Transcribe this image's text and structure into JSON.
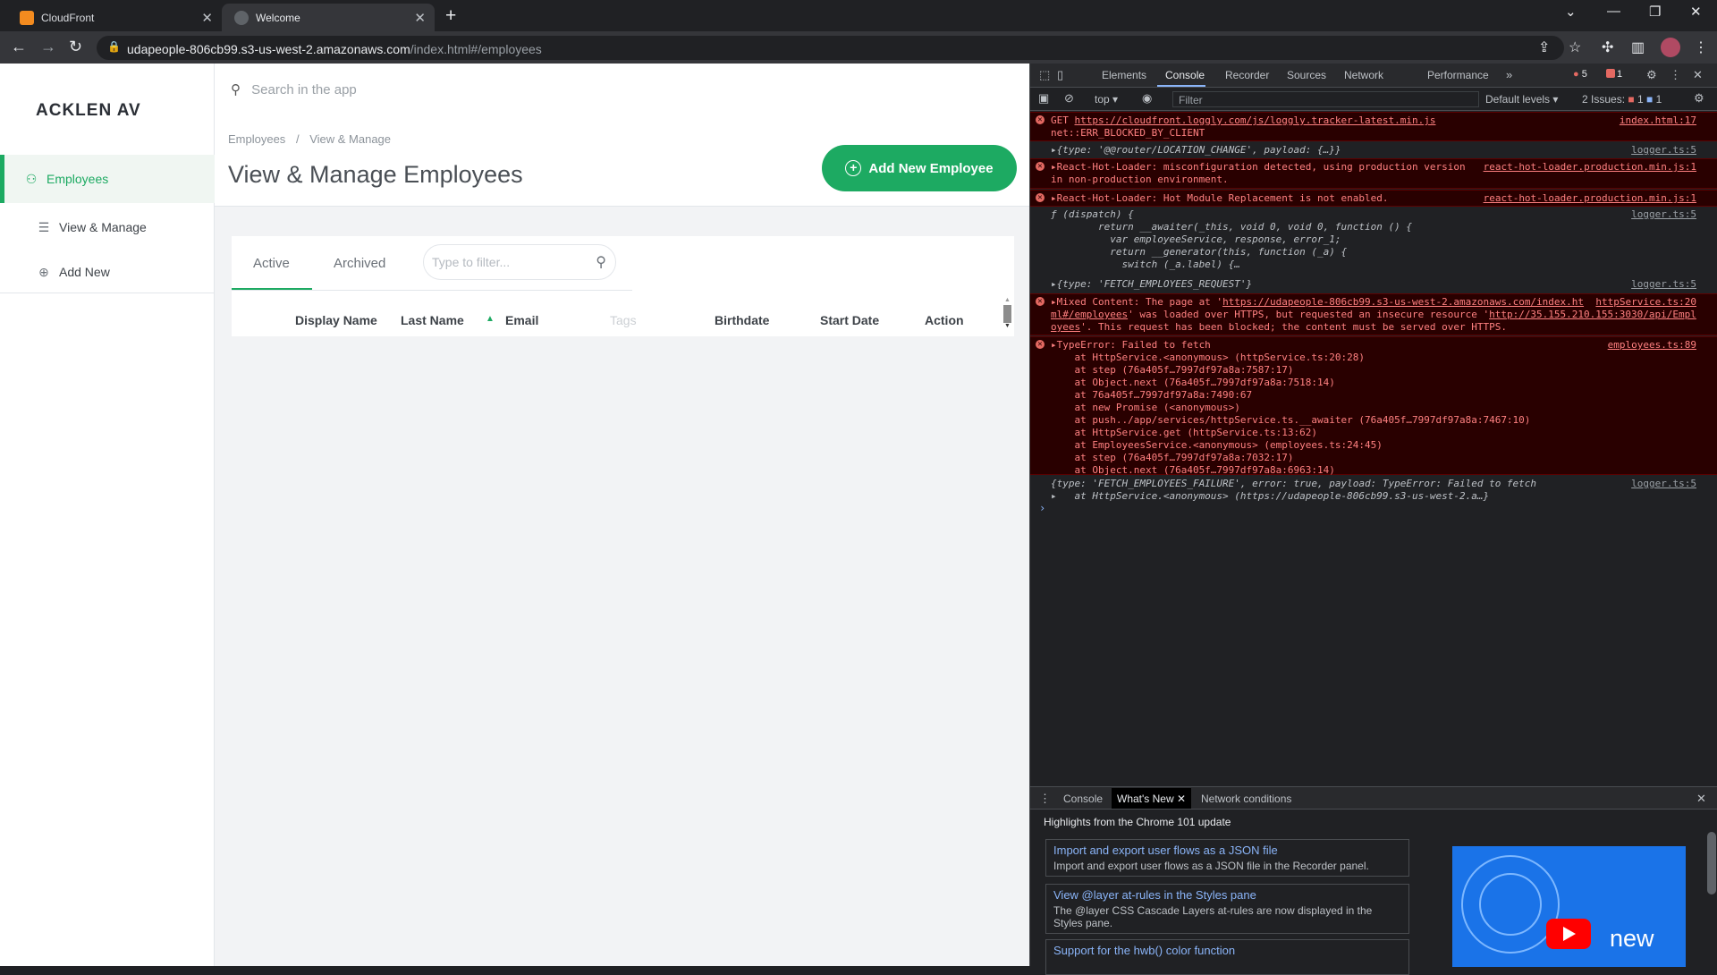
{
  "browser": {
    "tabs": [
      {
        "title": "CloudFront",
        "active": false,
        "favicon_color": "#f38b1f"
      },
      {
        "title": "Welcome",
        "active": true,
        "favicon_color": "#9aa0a6"
      }
    ],
    "url_host": "udapeople-806cb99.s3-us-west-2.amazonaws.com",
    "url_path": "/index.html#/employees"
  },
  "app": {
    "logo": "ACKLEN AV",
    "search_placeholder": "Search in the app",
    "sidebar": [
      {
        "label": "Employees",
        "icon": "user-icon",
        "active": true
      },
      {
        "label": "View & Manage",
        "icon": "list-icon",
        "active": false
      },
      {
        "label": "Add New",
        "icon": "plus-circle-icon",
        "active": false
      }
    ],
    "breadcrumb": {
      "root": "Employees",
      "sep": "/",
      "current": "View & Manage"
    },
    "page_title": "View & Manage Employees",
    "add_button": "Add New Employee",
    "filter_tabs": [
      "Active",
      "Archived"
    ],
    "filter_placeholder": "Type to filter...",
    "columns": [
      "Display Name",
      "Last Name",
      "Email",
      "Tags",
      "Birthdate",
      "Start Date",
      "Action"
    ],
    "accent_color": "#1daa62"
  },
  "devtools": {
    "tabs": [
      "Elements",
      "Console",
      "Recorder",
      "Sources",
      "Network",
      "Performance"
    ],
    "active_tab": "Console",
    "error_count": "5",
    "issue_count": "1",
    "context": "top",
    "filter_placeholder": "Filter",
    "levels": "Default levels",
    "issues_label": "2 Issues:",
    "issues_err": "1",
    "issues_info": "1",
    "messages": {
      "m1a": "GET ",
      "m1url": "https://cloudfront.loggly.com/js/loggly.tracker-latest.min.js",
      "m1b": "net::ERR_BLOCKED_BY_CLIENT",
      "m1src": "index.html:17",
      "m2": "▸{type: '@@router/LOCATION_CHANGE', payload: {…}}",
      "m2src": "logger.ts:5",
      "m3a": "▸React-Hot-Loader: misconfiguration detected, using production version",
      "m3b": "in non-production environment.",
      "m3src": "react-hot-loader.production.min.js:1",
      "m4": "▸React-Hot-Loader: Hot Module Replacement is not enabled.",
      "m4src": "react-hot-loader.production.min.js:1",
      "m5": "ƒ (dispatch) {\n        return __awaiter(_this, void 0, void 0, function () {\n          var employeeService, response, error_1;\n          return __generator(this, function (_a) {\n            switch (_a.label) {…",
      "m5src": "logger.ts:5",
      "m6": "▸{type: 'FETCH_EMPLOYEES_REQUEST'}",
      "m6src": "logger.ts:5",
      "m7a": "▸Mixed Content: The page at '",
      "m7url": "https://udapeople-806cb99.s3-us-west-2.amazonaws.com/index.ht",
      "m7url2": "ml#/employees",
      "m7b": "' was loaded over HTTPS, but requested an insecure resource '",
      "m7url3": "http://35.155.210.155:3030/api/Empl",
      "m7url4": "oyees",
      "m7c": "'. This request has been blocked; the content must be served over HTTPS.",
      "m7src": "httpService.ts:20",
      "m8": "▸TypeError: Failed to fetch\n    at HttpService.<anonymous> (httpService.ts:20:28)\n    at step (76a405f…7997df97a8a:7587:17)\n    at Object.next (76a405f…7997df97a8a:7518:14)\n    at 76a405f…7997df97a8a:7490:67\n    at new Promise (<anonymous>)\n    at push../app/services/httpService.ts.__awaiter (76a405f…7997df97a8a:7467:10)\n    at HttpService.get (httpService.ts:13:62)\n    at EmployeesService.<anonymous> (employees.ts:24:45)\n    at step (76a405f…7997df97a8a:7032:17)\n    at Object.next (76a405f…7997df97a8a:6963:14)",
      "m8src": "employees.ts:89",
      "m9": "{type: 'FETCH_EMPLOYEES_FAILURE', error: true, payload: TypeError: Failed to fetch\n▸   at HttpService.<anonymous> (https://udapeople-806cb99.s3-us-west-2.a…}",
      "m9src": "logger.ts:5"
    },
    "drawer": {
      "tabs": [
        "Console",
        "What's New",
        "Network conditions"
      ],
      "active_tab": "What's New",
      "title": "Highlights from the Chrome 101 update",
      "items": [
        {
          "title": "Import and export user flows as a JSON file",
          "desc": "Import and export user flows as a JSON file in the Recorder panel."
        },
        {
          "title": "View @layer at-rules in the Styles pane",
          "desc": "The @layer CSS Cascade Layers at-rules are now displayed in the Styles pane."
        },
        {
          "title": "Support for the hwb() color function",
          "desc": ""
        }
      ],
      "thumb_text": "new"
    }
  }
}
